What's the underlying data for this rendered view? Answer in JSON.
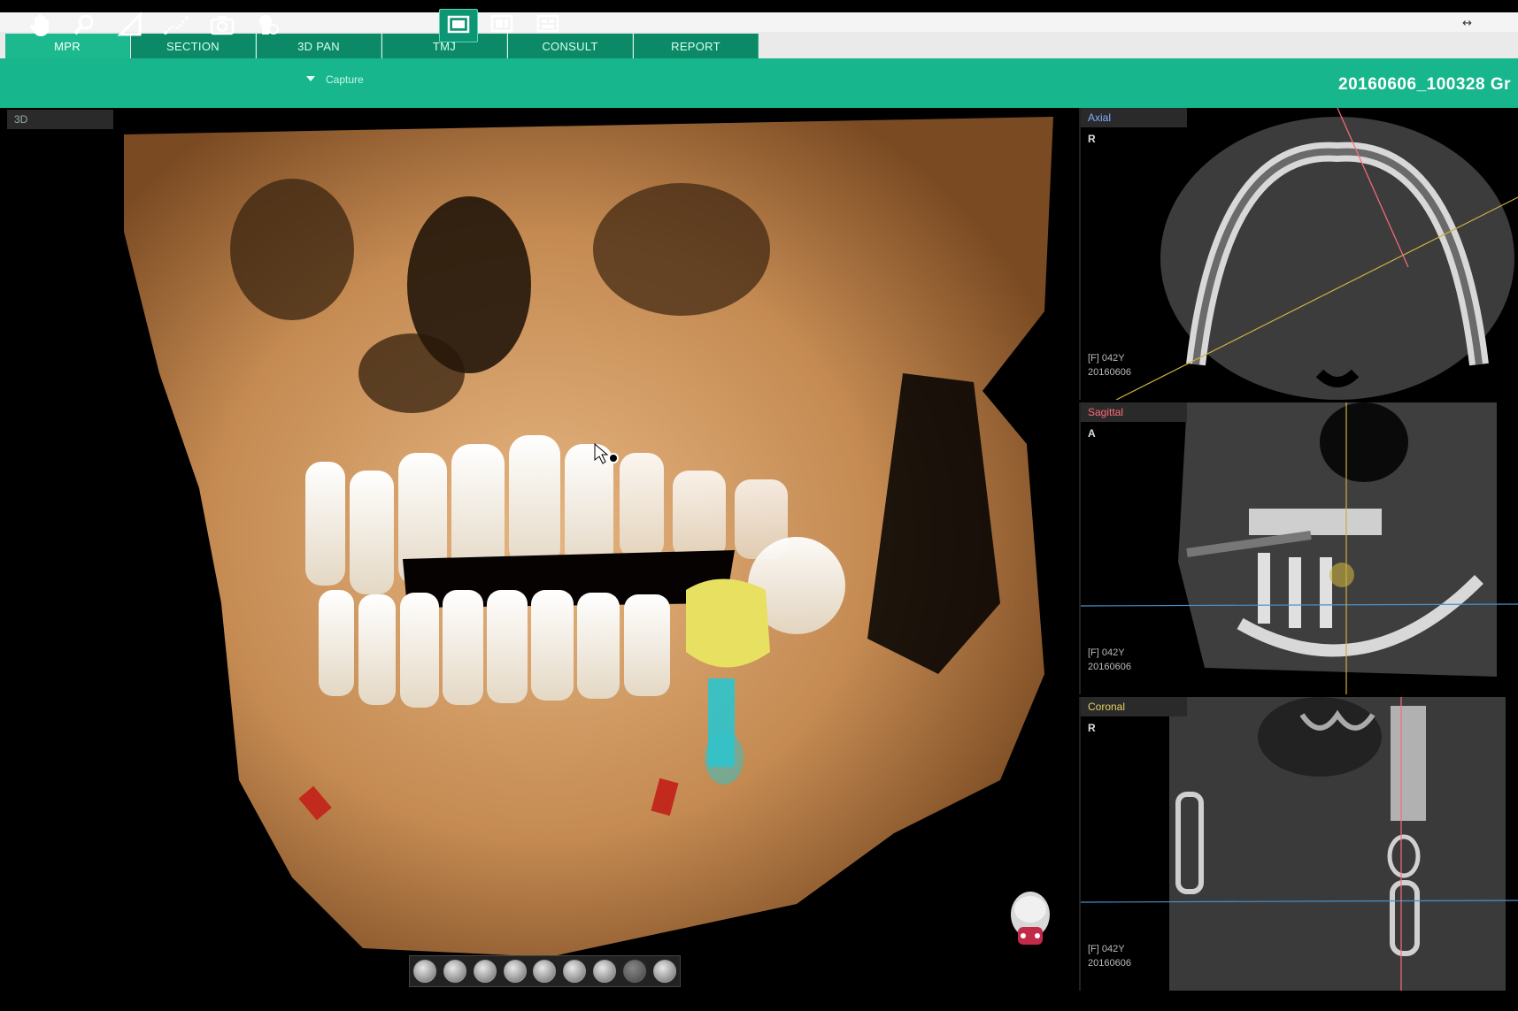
{
  "window": {
    "controls": "↔"
  },
  "tabs": [
    {
      "label": "MPR",
      "active": true
    },
    {
      "label": "SECTION",
      "active": false
    },
    {
      "label": "3D PAN",
      "active": false
    },
    {
      "label": "TMJ",
      "active": false
    },
    {
      "label": "CONSULT",
      "active": false
    },
    {
      "label": "REPORT",
      "active": false
    }
  ],
  "toolbar": {
    "capture_label": "Capture",
    "study_id": "20160606_100328 Gr"
  },
  "main_view": {
    "label": "3D"
  },
  "axial": {
    "label": "Axial",
    "orientation": "R",
    "patient": "[F] 042Y",
    "date": "20160606"
  },
  "sagittal": {
    "label": "Sagittal",
    "orientation": "A",
    "patient": "[F] 042Y",
    "date": "20160606"
  },
  "coronal": {
    "label": "Coronal",
    "orientation": "R",
    "patient": "[F] 042Y",
    "date": "20160606"
  },
  "colors": {
    "accent": "#17b68c",
    "tab_active": "#1bb98d",
    "bone": "#c8935a",
    "implant_crown": "#e8e060",
    "implant_post": "#2ec4cc",
    "marker": "#c22a1e"
  }
}
